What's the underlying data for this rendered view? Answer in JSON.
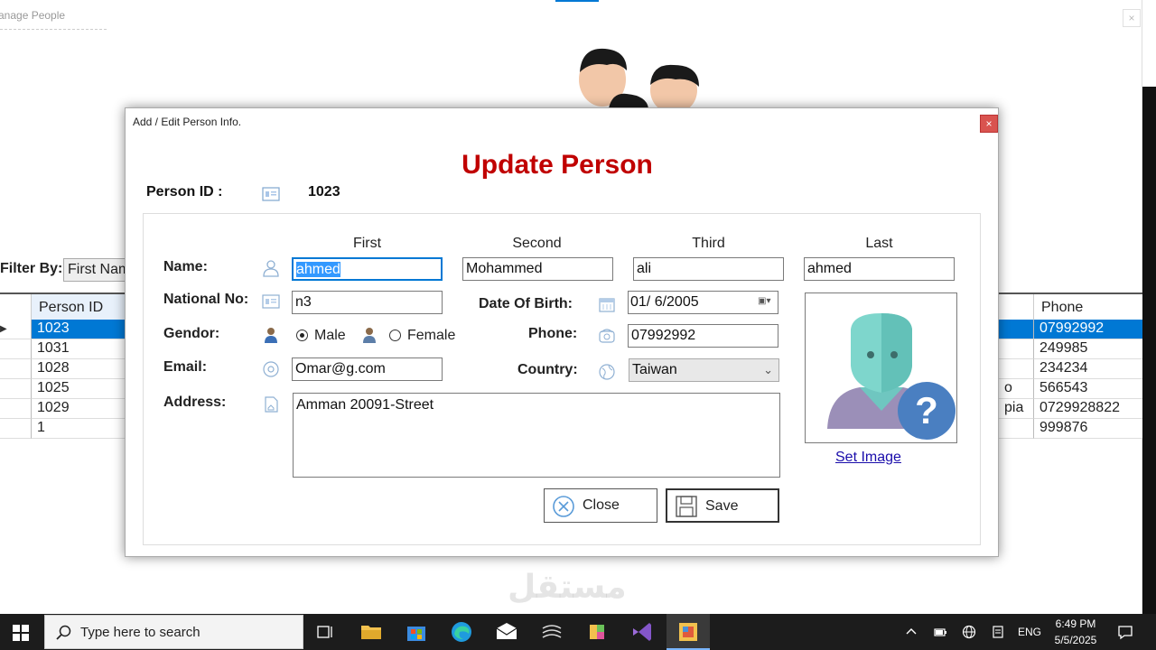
{
  "background_window": {
    "title": "anage People",
    "close_label": "×",
    "filter_label": "Filter By:",
    "filter_value": "First Nam",
    "grid": {
      "columns": [
        "Person ID",
        "Phone"
      ],
      "rows": [
        {
          "id": "1023",
          "country_tail": "",
          "phone": "07992992",
          "selected": true
        },
        {
          "id": "1031",
          "country_tail": "",
          "phone": "249985"
        },
        {
          "id": "1028",
          "country_tail": "",
          "phone": "234234"
        },
        {
          "id": "1025",
          "country_tail": "o",
          "phone": "566543"
        },
        {
          "id": "1029",
          "country_tail": "pia",
          "phone": "0729928822"
        },
        {
          "id": "1",
          "country_tail": "",
          "phone": "999876"
        }
      ]
    }
  },
  "dialog": {
    "title": "Add / Edit Person Info.",
    "close_label": "×",
    "heading": "Update Person",
    "person_id_label": "Person ID :",
    "person_id_value": "1023",
    "name_label": "Name:",
    "name_columns": {
      "first": "First",
      "second": "Second",
      "third": "Third",
      "last": "Last"
    },
    "name_values": {
      "first": "ahmed",
      "second": "Mohammed",
      "third": "ali",
      "last": "ahmed"
    },
    "national_no_label": "National No:",
    "national_no_value": "n3",
    "dob_label": "Date Of Birth:",
    "dob_value": "01/  6/2005",
    "gender_label": "Gendor:",
    "gender_male": "Male",
    "gender_female": "Female",
    "gender_selected": "Male",
    "phone_label": "Phone:",
    "phone_value": "07992992",
    "email_label": "Email:",
    "email_value": "Omar@g.com",
    "country_label": "Country:",
    "country_value": "Taiwan",
    "address_label": "Address:",
    "address_value": "Amman 20091-Street",
    "set_image_label": "Set Image",
    "close_button": "Close",
    "save_button": "Save"
  },
  "taskbar": {
    "search_placeholder": "Type here to search",
    "language": "ENG",
    "time": "6:49 PM",
    "date": "5/5/2025"
  },
  "watermark": "مستقل",
  "colors": {
    "heading": "#c00000",
    "selection": "#0078d4",
    "close_red": "#d9534f",
    "taskbar": "#1c1c1c"
  }
}
